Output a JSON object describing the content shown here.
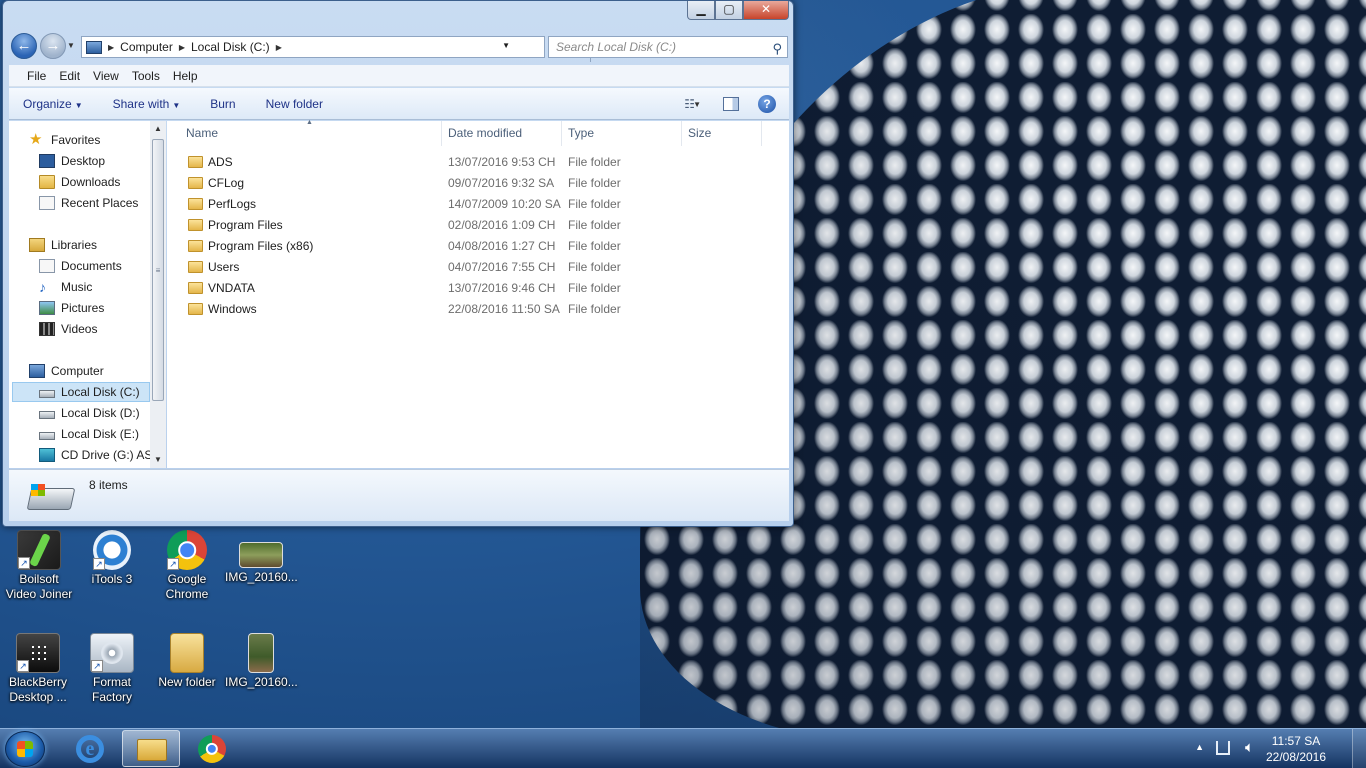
{
  "window": {
    "minimize": "▁",
    "maximize": "▢",
    "close": "✕"
  },
  "address": {
    "crumbs": [
      "Computer",
      "Local Disk (C:)"
    ],
    "search_placeholder": "Search Local Disk (C:)"
  },
  "menu": [
    "File",
    "Edit",
    "View",
    "Tools",
    "Help"
  ],
  "commands": {
    "organize": "Organize",
    "share_with": "Share with",
    "burn": "Burn",
    "new_folder": "New folder",
    "help": "?"
  },
  "nav_pane": {
    "favorites": "Favorites",
    "desktop": "Desktop",
    "downloads": "Downloads",
    "recent_places": "Recent Places",
    "libraries": "Libraries",
    "documents": "Documents",
    "music": "Music",
    "pictures": "Pictures",
    "videos": "Videos",
    "computer": "Computer",
    "local_disk_c": "Local Disk (C:)",
    "local_disk_d": "Local Disk (D:)",
    "local_disk_e": "Local Disk (E:)",
    "cd_drive": "CD Drive (G:) ASU"
  },
  "columns": {
    "name": "Name",
    "date_modified": "Date modified",
    "type": "Type",
    "size": "Size"
  },
  "files": [
    {
      "name": "ADS",
      "date": "13/07/2016 9:53 CH",
      "type": "File folder"
    },
    {
      "name": "CFLog",
      "date": "09/07/2016 9:32 SA",
      "type": "File folder"
    },
    {
      "name": "PerfLogs",
      "date": "14/07/2009 10:20 SA",
      "type": "File folder"
    },
    {
      "name": "Program Files",
      "date": "02/08/2016 1:09 CH",
      "type": "File folder"
    },
    {
      "name": "Program Files (x86)",
      "date": "04/08/2016 1:27 CH",
      "type": "File folder"
    },
    {
      "name": "Users",
      "date": "04/07/2016 7:55 CH",
      "type": "File folder"
    },
    {
      "name": "VNDATA",
      "date": "13/07/2016 9:46 CH",
      "type": "File folder"
    },
    {
      "name": "Windows",
      "date": "22/08/2016 11:50 SA",
      "type": "File folder"
    }
  ],
  "details": {
    "item_count": "8 items"
  },
  "desktop_icons": {
    "boilsoft_line1": "Boilsoft",
    "boilsoft_line2": "Video Joiner",
    "itools": "iTools 3",
    "chrome_line1": "Google",
    "chrome_line2": "Chrome",
    "img1": "IMG_20160...",
    "blackberry_line1": "BlackBerry",
    "blackberry_line2": "Desktop ...",
    "format_line1": "Format",
    "format_line2": "Factory",
    "new_folder": "New folder",
    "img2": "IMG_20160..."
  },
  "tray": {
    "time": "11:57 SA",
    "date": "22/08/2016"
  },
  "colors": {
    "selection": "#cce4f7",
    "link_text": "#1e3287",
    "secondary_text": "#6d6d6d"
  }
}
